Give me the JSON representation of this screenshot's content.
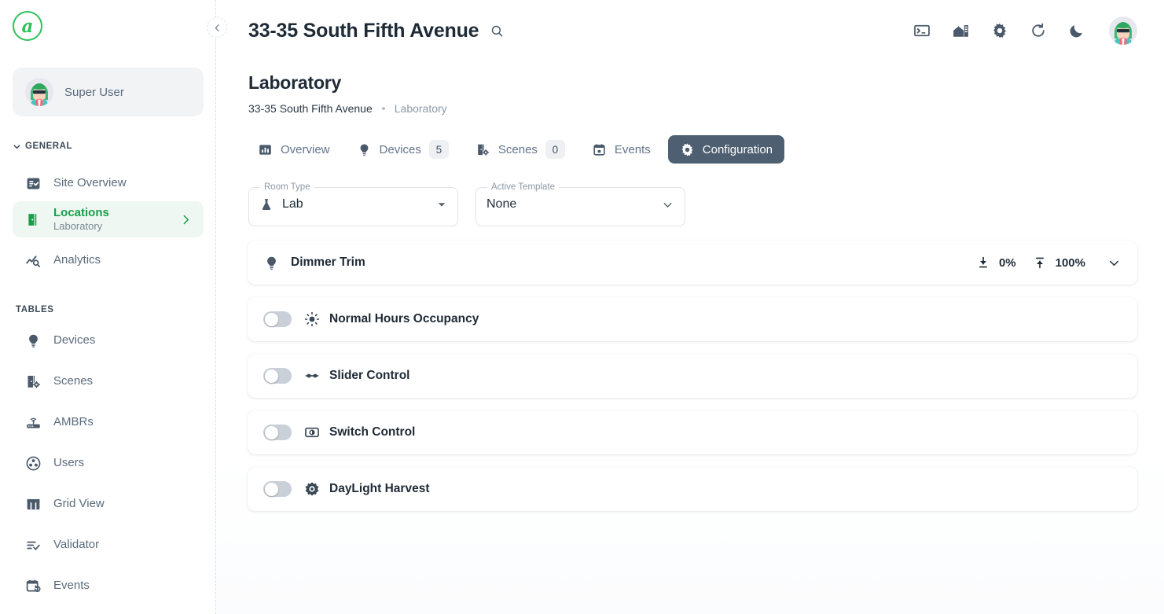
{
  "brand": {
    "logo_letter": "a",
    "logo_color": "#2fc25b"
  },
  "sidebar": {
    "user": {
      "name": "Super User"
    },
    "sections": [
      {
        "title": "GENERAL"
      },
      {
        "title": "TABLES"
      }
    ],
    "general_items": [
      {
        "label": "Site Overview",
        "icon": "site-overview-icon",
        "sub": ""
      },
      {
        "label": "Locations",
        "icon": "door-icon",
        "sub": "Laboratory",
        "active": true
      },
      {
        "label": "Analytics",
        "icon": "analytics-icon",
        "sub": ""
      }
    ],
    "tables_items": [
      {
        "label": "Devices",
        "icon": "bulb-icon"
      },
      {
        "label": "Scenes",
        "icon": "scenes-icon"
      },
      {
        "label": "AMBRs",
        "icon": "router-icon"
      },
      {
        "label": "Users",
        "icon": "users-icon"
      },
      {
        "label": "Grid View",
        "icon": "grid-icon"
      },
      {
        "label": "Validator",
        "icon": "validator-icon"
      },
      {
        "label": "Events",
        "icon": "calendar-history-icon"
      }
    ]
  },
  "topbar": {
    "title": "33-35 South Fifth Avenue",
    "icons": [
      "terminal-icon",
      "building-home-icon",
      "gear-icon",
      "refresh-icon",
      "dark-mode-moon-icon"
    ]
  },
  "page": {
    "title": "Laboratory",
    "breadcrumb": {
      "parent": "33-35 South Fifth Avenue",
      "current": "Laboratory"
    }
  },
  "tabs": [
    {
      "label": "Overview",
      "icon": "chart-bar-icon",
      "badge": null,
      "active": false
    },
    {
      "label": "Devices",
      "icon": "bulb-icon",
      "badge": "5",
      "active": false
    },
    {
      "label": "Scenes",
      "icon": "scenes-icon",
      "badge": "0",
      "active": false
    },
    {
      "label": "Events",
      "icon": "calendar-icon",
      "badge": null,
      "active": false
    },
    {
      "label": "Configuration",
      "icon": "gear-icon",
      "badge": null,
      "active": true
    }
  ],
  "fields": {
    "room_type": {
      "legend": "Room Type",
      "value": "Lab",
      "icon": "flask-icon"
    },
    "active_template": {
      "legend": "Active Template",
      "value": "None"
    }
  },
  "rows": [
    {
      "label": "Dimmer Trim",
      "icon": "bulb-icon",
      "type": "expandable",
      "min_label": "0%",
      "max_label": "100%"
    },
    {
      "label": "Normal Hours Occupancy",
      "icon": "sun-occupancy-icon",
      "type": "toggle",
      "on": false
    },
    {
      "label": "Slider Control",
      "icon": "slider-icon",
      "type": "toggle",
      "on": false
    },
    {
      "label": "Switch Control",
      "icon": "switch-icon",
      "type": "toggle",
      "on": false
    },
    {
      "label": "DayLight Harvest",
      "icon": "brightness-icon",
      "type": "toggle",
      "on": false
    }
  ],
  "colors": {
    "accent_green": "#1a9e4b",
    "active_tab_bg": "#4d5f70",
    "slate": "#4a5a6a"
  }
}
